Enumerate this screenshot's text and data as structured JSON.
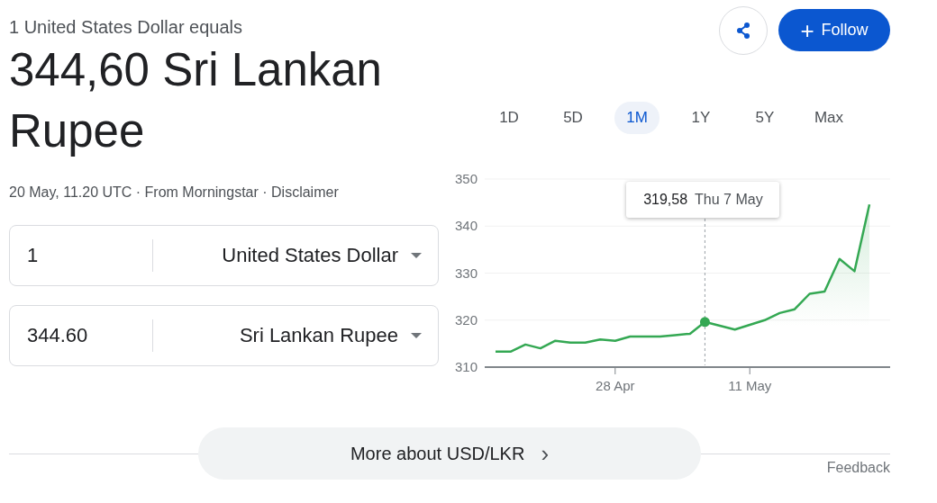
{
  "header": {
    "subtitle": "1 United States Dollar equals",
    "rate": "344,60 Sri Lankan Rupee",
    "source": "20 May, 11.20 UTC · From Morningstar · ",
    "disclaimer": "Disclaimer"
  },
  "actions": {
    "follow": "Follow",
    "follow_icon": "+"
  },
  "converter": [
    {
      "amount": "1",
      "currency": "United States Dollar"
    },
    {
      "amount": "344.60",
      "currency": "Sri Lankan Rupee"
    }
  ],
  "ranges": [
    {
      "label": "1D",
      "selected": false
    },
    {
      "label": "5D",
      "selected": false
    },
    {
      "label": "1M",
      "selected": true
    },
    {
      "label": "1Y",
      "selected": false
    },
    {
      "label": "5Y",
      "selected": false
    },
    {
      "label": "Max",
      "selected": false
    }
  ],
  "chart": {
    "hover_date": "Thu 7 May",
    "chart_data": {
      "type": "line",
      "grid": true,
      "ylim": [
        310,
        350
      ],
      "yticks": [
        310,
        320,
        330,
        340,
        350
      ],
      "categories": [
        null,
        null,
        null,
        null,
        null,
        null,
        null,
        null,
        "28 Apr",
        null,
        null,
        null,
        null,
        null,
        null,
        null,
        null,
        "11 May",
        null,
        null,
        null,
        null,
        null,
        null,
        null,
        null
      ],
      "series": [
        {
          "color": "#34a853",
          "values": [
            313.3,
            313.3,
            314.8,
            314.0,
            315.6,
            315.2,
            315.2,
            315.9,
            315.6,
            316.5,
            316.5,
            316.5,
            316.8,
            317.1,
            319.6,
            318.8,
            318.0,
            319.0,
            320.0,
            321.5,
            322.3,
            325.6,
            326.1,
            333.0,
            330.4,
            344.6
          ]
        }
      ],
      "annotations": [
        "319,58"
      ]
    }
  },
  "more_button": {
    "label": "More about USD/LKR",
    "icon": "›"
  },
  "feedback": "Feedback"
}
